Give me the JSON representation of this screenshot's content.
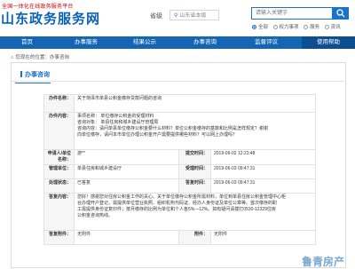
{
  "header": {
    "site_subtitle": "全国一体化在线政务服务平台",
    "site_title": "山东政务服务网",
    "level_label": "省级",
    "region": "山东省本级",
    "search_placeholder": "请输入关键字",
    "search_options": [
      {
        "label": "全部",
        "selected": true
      },
      {
        "label": "权力事项",
        "selected": false
      },
      {
        "label": "服务",
        "selected": false
      },
      {
        "label": "资讯",
        "selected": false
      }
    ]
  },
  "nav": {
    "items": [
      "首页",
      "办事服务",
      "结果公示",
      "办事咨询",
      "监督评议",
      "使用帮助"
    ],
    "active_index": 5
  },
  "breadcrumb": "您现在的位置：办事咨询",
  "card": {
    "title": "办事咨询",
    "rows": {
      "item_label": "办件名称：",
      "item_value": "关于菏泽市单县公积金缴存贷款问题的咨询",
      "content_label": "办件内容：",
      "content_lines": [
        "事项名称：    单位缴存公积金的受理材料",
        "咨询对象：    单县住房和城乡建设厅管理局",
        "咨询内容：请问单县单位缴存公积金要什么材料？单位公积金缴存的基数和比例是怎样规定？谢谢",
        "向单位缴存，请问本市单位办理公积金开户需要提供哪些材料？可以网上办理吗？"
      ],
      "applicant_label": "申请人/单位名称：",
      "applicant_value": "游**",
      "submit_time_label": "提交时间：",
      "submit_time_value": "2019-06-02 12:22:48",
      "dept_label": "管理单位：",
      "dept_value": "单县住房和城乡建设厅",
      "reply_time_label": "受理时间：",
      "reply_time_value": "2019-06-03 09:47:31",
      "status_label": "处理状态：",
      "status_value": "已答复",
      "reply_time2_label": "答复时间：",
      "reply_time2_value": "2019-06-03 09:47:31",
      "answer_label": "答复内容：",
      "answer_lines": [
        "您好！感谢您对住房公积金工作的关心。关于单位缴存公积金所需材料，单位到单县住房公积金管理中心柜",
        "台办理开户登记，需提供单位营业执照、组织机构代码证、经办人身份证及单位公章等。首次缴存的职",
        "工需提供身份证复印件；按月缴存的比例为单位和个人各5%—12%。如有疑问请拨打0530-12329住房",
        "公积金咨询热线。"
      ],
      "attach_label": "答复附件：",
      "attach_value": "无附件",
      "attach_label2": "附件：",
      "attach_value2": "无附件"
    }
  },
  "watermark": "鲁青房产"
}
